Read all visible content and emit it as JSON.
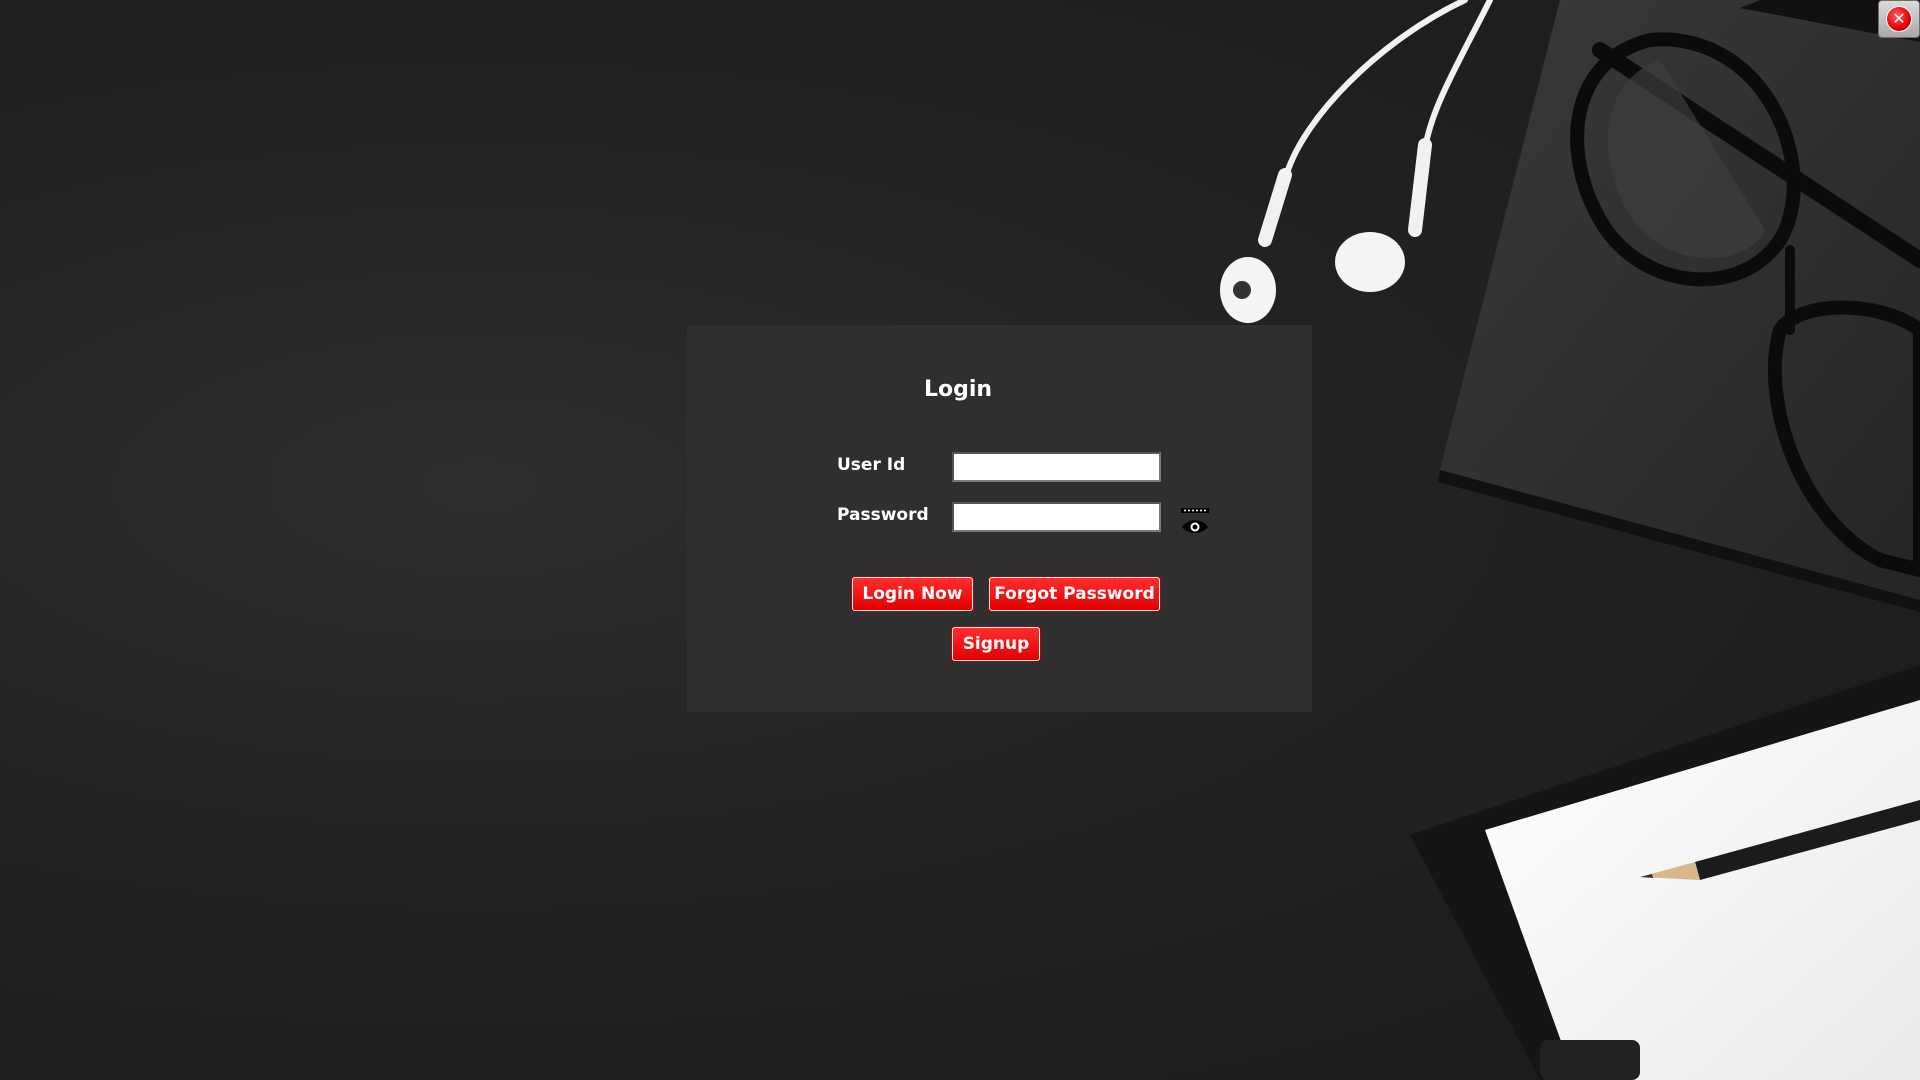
{
  "window": {
    "close_icon": "close-icon",
    "close_glyph": "✕"
  },
  "login": {
    "title": "Login",
    "userid_label": "User Id",
    "userid_value": "",
    "password_label": "Password",
    "password_value": "",
    "show_password_icon": "eye-icon",
    "login_button": "Login Now",
    "forgot_button": "Forgot Password",
    "signup_button": "Signup"
  },
  "colors": {
    "panel": "#2f2f30",
    "button": "#ee0000",
    "background": "#1e1e1e"
  }
}
